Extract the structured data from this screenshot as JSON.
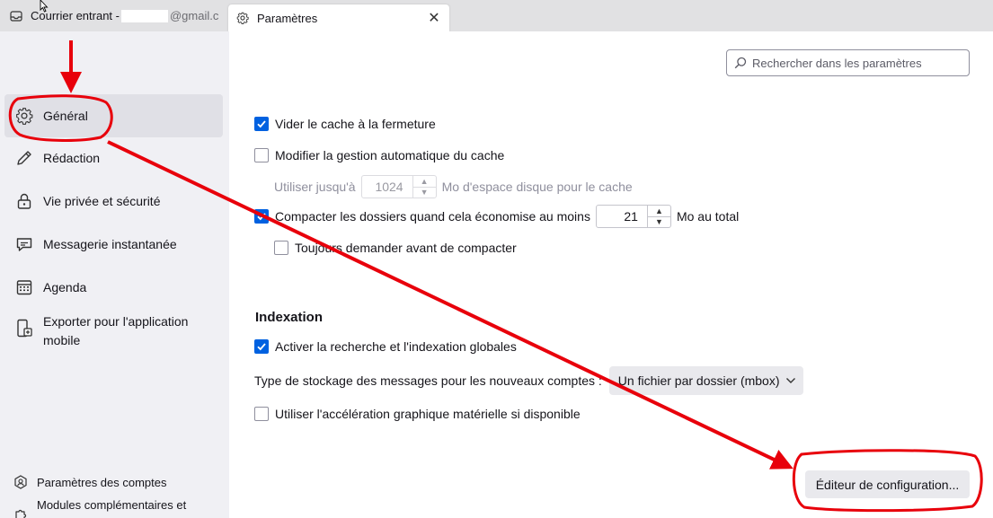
{
  "tabs": {
    "inbox_label_prefix": "Courrier entrant -",
    "inbox_label_suffix": "@gmail.c",
    "settings_label": "Paramètres",
    "close_glyph": "✕"
  },
  "sidebar": {
    "items": [
      {
        "label": "Général",
        "icon": "gear-icon"
      },
      {
        "label": "Rédaction",
        "icon": "pencil-icon"
      },
      {
        "label": "Vie privée et sécurité",
        "icon": "lock-icon"
      },
      {
        "label": "Messagerie instantanée",
        "icon": "chat-icon"
      },
      {
        "label": "Agenda",
        "icon": "calendar-icon"
      },
      {
        "label": "Exporter pour l'application mobile",
        "icon": "mobile-export-icon"
      }
    ],
    "footer": [
      {
        "label": "Paramètres des comptes",
        "icon": "accounts-icon"
      },
      {
        "label": "Modules complémentaires et",
        "icon": "puzzle-icon"
      }
    ]
  },
  "search": {
    "placeholder": "Rechercher dans les paramètres"
  },
  "settings": {
    "clear_cache_label": "Vider le cache à la fermeture",
    "clear_cache_checked": true,
    "override_cache_label": "Modifier la gestion automatique du cache",
    "override_cache_checked": false,
    "use_up_to_label": "Utiliser jusqu'à",
    "cache_size_value": "1024",
    "cache_size_unit": "Mo d'espace disque pour le cache",
    "compact_label": "Compacter les dossiers quand cela économise au moins",
    "compact_checked": true,
    "compact_value": "21",
    "compact_unit": "Mo au total",
    "always_ask_label": "Toujours demander avant de compacter",
    "always_ask_checked": false
  },
  "indexation": {
    "heading": "Indexation",
    "global_search_label": "Activer la recherche et l'indexation globales",
    "global_search_checked": true,
    "storage_type_label": "Type de stockage des messages pour les nouveaux comptes :",
    "storage_type_value": "Un fichier par dossier (mbox)",
    "hw_accel_label": "Utiliser l'accélération graphique matérielle si disponible",
    "hw_accel_checked": false
  },
  "config_editor_button": "Éditeur de configuration...",
  "colors": {
    "accent": "#0061e0",
    "annotation": "#e8000b"
  }
}
